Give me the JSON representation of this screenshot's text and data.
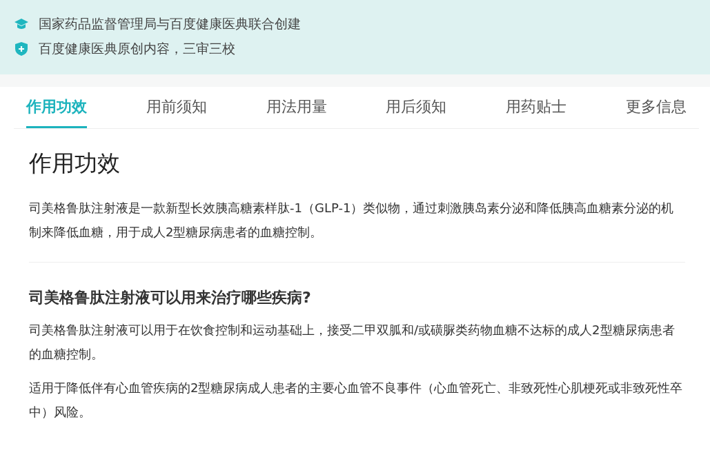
{
  "banner": {
    "lines": [
      {
        "kind": "cap",
        "text": "国家药品监督管理局与百度健康医典联合创建"
      },
      {
        "kind": "shield",
        "text": "百度健康医典原创内容，三审三校"
      }
    ]
  },
  "tabs": [
    {
      "label": "作用功效",
      "selected": true
    },
    {
      "label": "用前须知",
      "selected": false
    },
    {
      "label": "用法用量",
      "selected": false
    },
    {
      "label": "用后须知",
      "selected": false
    },
    {
      "label": "用药贴士",
      "selected": false
    },
    {
      "label": "更多信息",
      "selected": false
    }
  ],
  "section": {
    "title": "作用功效",
    "intro": "司美格鲁肽注射液是一款新型长效胰高糖素样肽-1（GLP-1）类似物，通过刺激胰岛素分泌和降低胰高血糖素分泌的机制来降低血糖，用于成人2型糖尿病患者的血糖控制。",
    "question": "司美格鲁肽注射液可以用来治疗哪些疾病?",
    "answers": [
      "司美格鲁肽注射液可以用于在饮食控制和运动基础上，接受二甲双胍和/或磺脲类药物血糖不达标的成人2型糖尿病患者的血糖控制。",
      "适用于降低伴有心血管疾病的2型糖尿病成人患者的主要心血管不良事件（心血管死亡、非致死性心肌梗死或非致死性卒中）风险。"
    ]
  }
}
